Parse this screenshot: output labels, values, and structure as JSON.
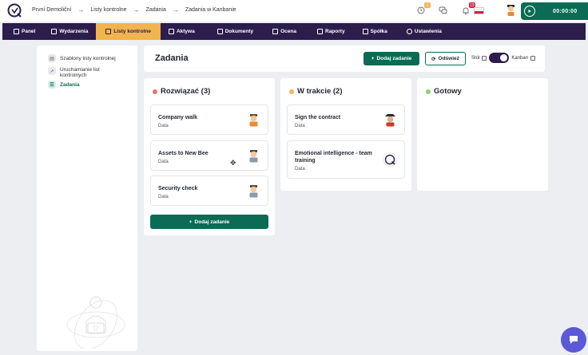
{
  "breadcrumb": [
    "První Demoliční",
    "Listy kontrolne",
    "Zadania",
    "Zadania w Kanbanie"
  ],
  "top": {
    "notif_badge_1": "3",
    "notif_badge_2": "19",
    "timer": "00:00:00",
    "accent_green": "#0b6b55",
    "nav_bg": "#2c1d4d",
    "nav_active": "#f2b44d"
  },
  "nav": [
    {
      "label": "Panel",
      "icon": "grid-icon"
    },
    {
      "label": "Wydarzenia",
      "icon": "calendar-icon"
    },
    {
      "label": "Listy kontrolne",
      "icon": "checklist-icon",
      "active": true
    },
    {
      "label": "Aktywa",
      "icon": "tools-icon"
    },
    {
      "label": "Dokumenty",
      "icon": "folder-icon"
    },
    {
      "label": "Ocena",
      "icon": "target-icon"
    },
    {
      "label": "Raporty",
      "icon": "chart-icon"
    },
    {
      "label": "Spółka",
      "icon": "building-icon"
    },
    {
      "label": "Ustawienia",
      "icon": "gear-icon"
    }
  ],
  "sidebar": {
    "items": [
      {
        "label": "Szablony listy kontrolnej"
      },
      {
        "label": "Uruchamianie list kontrolnych"
      },
      {
        "label": "Zadania",
        "active": true
      }
    ]
  },
  "header": {
    "title": "Zadania",
    "add_label": "Dodaj zadanie",
    "refresh_label": "Odśwież",
    "view_table": "Stół",
    "view_kanban": "Kanban"
  },
  "columns": [
    {
      "title": "Rozwiązać (3)",
      "dot_color": "#e8756b",
      "cards": [
        {
          "title": "Company walk",
          "sub": "Data"
        },
        {
          "title": "Assets to New Bee",
          "sub": "Data"
        },
        {
          "title": "Security check",
          "sub": "Data"
        }
      ],
      "add_label": "Dodaj zadanie"
    },
    {
      "title": "W trakcie (2)",
      "dot_color": "#f2b46a",
      "cards": [
        {
          "title": "Sign the contract",
          "sub": "Data"
        },
        {
          "title": "Emotional intelligence - team training",
          "sub": "Data"
        }
      ]
    },
    {
      "title": "Gotowy",
      "dot_color": "#8cd36b",
      "cards": []
    }
  ]
}
